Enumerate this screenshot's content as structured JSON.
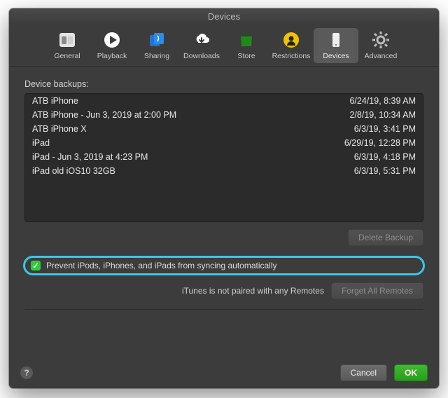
{
  "window": {
    "title": "Devices"
  },
  "toolbar": {
    "items": [
      {
        "label": "General"
      },
      {
        "label": "Playback"
      },
      {
        "label": "Sharing"
      },
      {
        "label": "Downloads"
      },
      {
        "label": "Store"
      },
      {
        "label": "Restrictions"
      },
      {
        "label": "Devices"
      },
      {
        "label": "Advanced"
      }
    ],
    "selected_index": 6
  },
  "backups": {
    "heading": "Device backups:",
    "rows": [
      {
        "name": "ATB iPhone",
        "date": "6/24/19, 8:39 AM"
      },
      {
        "name": "ATB iPhone - Jun 3, 2019 at 2:00 PM",
        "date": "2/8/19, 10:34 AM"
      },
      {
        "name": "ATB iPhone X",
        "date": "6/3/19, 3:41 PM"
      },
      {
        "name": "iPad",
        "date": "6/29/19, 12:28 PM"
      },
      {
        "name": "iPad - Jun 3, 2019 at 4:23 PM",
        "date": "6/3/19, 4:18 PM"
      },
      {
        "name": "iPad old iOS10 32GB",
        "date": "6/3/19, 5:31 PM"
      }
    ],
    "delete_label": "Delete Backup"
  },
  "prevent_sync": {
    "checked": true,
    "label": "Prevent iPods, iPhones, and iPads from syncing automatically"
  },
  "remotes": {
    "status": "iTunes is not paired with any Remotes",
    "button": "Forget All Remotes"
  },
  "footer": {
    "cancel": "Cancel",
    "ok": "OK"
  },
  "colors": {
    "highlight": "#38c7e8",
    "ok_button": "#2ecc40"
  }
}
